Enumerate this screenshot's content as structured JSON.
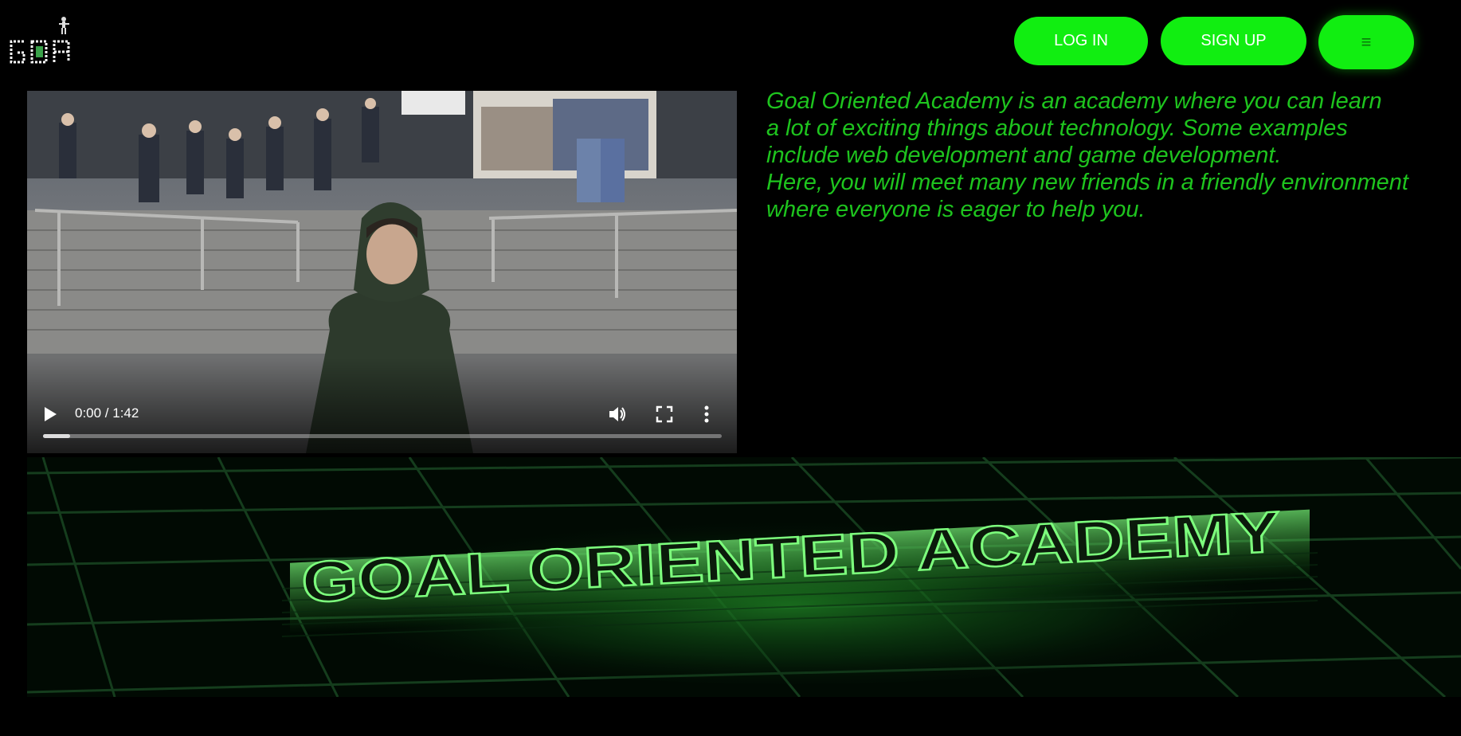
{
  "brand": {
    "logo_text": "GOA",
    "icon": "mascot-logo-icon",
    "color": "#11ee11"
  },
  "header": {
    "login_label": "LOG IN",
    "signup_label": "SIGN UP",
    "menu_label": "≡",
    "menu_icon": "hamburger-menu-icon"
  },
  "video": {
    "time": "0:00 / 1:42",
    "progress_fraction": 0.04,
    "icons": [
      "play-icon",
      "volume-icon",
      "fullscreen-icon",
      "more-options-icon"
    ]
  },
  "intro": {
    "paragraph": "Goal Oriented Academy is an academy where you can learn\na lot of exciting things about technology. Some examples\ninclude web development and game development.\nHere, you will meet many new friends in a friendly environment\nwhere everyone is eager to help you."
  },
  "banner": {
    "title": "GOAL ORIENTED ACADEMY",
    "accent": "#3dff3d"
  },
  "footer": {
    "text": ""
  }
}
